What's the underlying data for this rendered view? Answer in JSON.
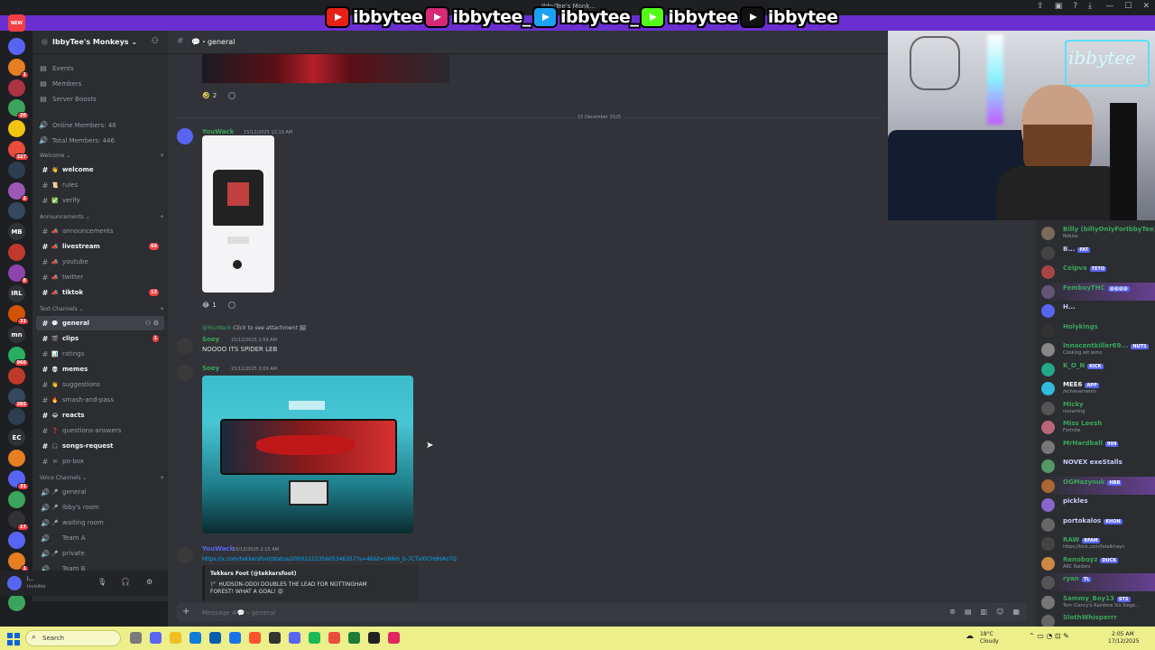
{
  "window": {
    "title": "IbbyTee's Monk..."
  },
  "socials": [
    {
      "platform": "youtube-icon",
      "color": "#e62117",
      "handle": "ibbytee"
    },
    {
      "platform": "instagram-icon",
      "color": "#d62976",
      "handle": "ibbytee_"
    },
    {
      "platform": "twitter-icon",
      "color": "#1da1f2",
      "handle": "ibbytee_"
    },
    {
      "platform": "kick-icon",
      "color": "#53fc18",
      "handle": "ibbytee"
    },
    {
      "platform": "tiktok-icon",
      "color": "#111111",
      "handle": "ibbytee"
    }
  ],
  "rail": {
    "labels": [
      "NEW",
      "MB",
      "IRL",
      "mn",
      "EC"
    ],
    "badges": [
      "1",
      "20",
      "327",
      "2",
      "8",
      "31",
      "966",
      "202",
      "31",
      "17",
      "1"
    ]
  },
  "server": {
    "name": "IbbyTee's Monkeys",
    "top_items": [
      {
        "label": "Events",
        "icon": "calendar-icon"
      },
      {
        "label": "Members",
        "icon": "members-icon"
      },
      {
        "label": "Server Boosts",
        "icon": "boost-icon"
      }
    ],
    "stats": [
      {
        "label": "Online Members: 48"
      },
      {
        "label": "Total Members: 446"
      }
    ]
  },
  "categories": [
    {
      "name": "Welcome",
      "channels": [
        {
          "emoji": "👋",
          "name": "welcome",
          "unread": true
        },
        {
          "emoji": "📜",
          "name": "rules"
        },
        {
          "emoji": "✅",
          "name": "verify"
        }
      ]
    },
    {
      "name": "Announcements",
      "channels": [
        {
          "emoji": "📣",
          "name": "announcements"
        },
        {
          "emoji": "📣",
          "name": "livestream",
          "unread": true,
          "badge": "64"
        },
        {
          "emoji": "📣",
          "name": "youtube"
        },
        {
          "emoji": "📣",
          "name": "twitter"
        },
        {
          "emoji": "📣",
          "name": "tiktok",
          "unread": true,
          "badge": "13"
        }
      ]
    },
    {
      "name": "Text Channels",
      "channels": [
        {
          "emoji": "💬",
          "name": "general",
          "active": true
        },
        {
          "emoji": "🎬",
          "name": "clips",
          "unread": true,
          "badge": "1"
        },
        {
          "emoji": "📊",
          "name": "ratings"
        },
        {
          "emoji": "💀",
          "name": "memes",
          "unread": true
        },
        {
          "emoji": "👋",
          "name": "suggestions"
        },
        {
          "emoji": "🔥",
          "name": "smash-and-pass"
        },
        {
          "emoji": "😂",
          "name": "reacts",
          "unread": true
        },
        {
          "emoji": "❓",
          "name": "questions-answers"
        },
        {
          "emoji": "🎧",
          "name": "songs-request",
          "unread": true
        },
        {
          "emoji": "✉",
          "name": "po-box"
        }
      ]
    },
    {
      "name": "Voice Channels",
      "channels": [
        {
          "emoji": "🎤",
          "name": "general",
          "voice": true
        },
        {
          "emoji": "🎤",
          "name": "ibby's room",
          "voice": true
        },
        {
          "emoji": "🎤",
          "name": "waiting room",
          "voice": true
        },
        {
          "emoji": "",
          "name": "Team A",
          "voice": true
        },
        {
          "emoji": "🎤",
          "name": "private",
          "voice": true
        },
        {
          "emoji": "",
          "name": "Team B",
          "voice": true
        }
      ]
    }
  ],
  "user": {
    "name": "i...",
    "status": "Invisible"
  },
  "channel": {
    "name": "general"
  },
  "messages": {
    "react1": {
      "emoji": "🤣",
      "count": "2"
    },
    "date_divider": "15 December 2025",
    "m1": {
      "author": "YouWack",
      "time": "15/12/2025 12:19 AM"
    },
    "react2": {
      "emoji": "😂",
      "count": "1"
    },
    "reply_ref": {
      "name": "@YouWack",
      "text": "Click to see attachment"
    },
    "m2": {
      "author": "Soey",
      "time": "15/12/2025 1:59 AM",
      "text": "NOOOO ITS SPIDER LEB"
    },
    "m3": {
      "author": "Soey",
      "time": "15/12/2025 2:09 AM"
    },
    "m4": {
      "author": "YouWack",
      "time": "15/12/2025 2:15 AM",
      "link": "https://x.com/tekkersfoot/status/2000221535605346357?s=46&t=n86m_b-7CTxl0CHdHAo7Q",
      "embed_title": "Tekkers Foot (@tekkersfoot)",
      "embed_line1": "🏴 HUDSON-ODOI DOUBLES THE LEAD FOR NOTTINGHAM",
      "embed_line2": "FOREST! WHAT A GOAL! 😍"
    }
  },
  "composer": {
    "placeholder": "Message #💬・general"
  },
  "members": [
    {
      "name": "Billy (billyOnlyForIbbyTee)",
      "status": "Roblox",
      "color": "#3ba55d",
      "avatar": "#7a6a5a"
    },
    {
      "name": "B...",
      "tag": "FAT",
      "status": "",
      "color": "#c9cdfb",
      "avatar": "#444"
    },
    {
      "name": "Ceipva",
      "tag": "TETO",
      "status": "",
      "color": "#3ba55d",
      "avatar": "#aa4444"
    },
    {
      "name": "FemboyTHC",
      "tag": "@@@@",
      "status": "",
      "color": "#3ba55d",
      "avatar": "#665577",
      "hl": true
    },
    {
      "name": "H...",
      "status": "",
      "color": "#c9cdfb",
      "avatar": "#5865f2"
    },
    {
      "name": "Holykings",
      "status": "",
      "color": "#3ba55d",
      "avatar": "#333"
    },
    {
      "name": "Innocentkiller69...",
      "tag": "NUTS",
      "status": "Cooking wit lemo",
      "color": "#3ba55d",
      "avatar": "#888"
    },
    {
      "name": "K_O_N",
      "tag": "KICK",
      "status": "",
      "color": "#3ba55d",
      "avatar": "#2a8"
    },
    {
      "name": "MEE6",
      "tag": "APP",
      "status": "/achievements",
      "color": "#f2f3f5",
      "avatar": "#3bd"
    },
    {
      "name": "Micky",
      "status": "restarting",
      "color": "#3ba55d",
      "avatar": "#555"
    },
    {
      "name": "Miss Leesh",
      "status": "Fortnite",
      "color": "#3ba55d",
      "avatar": "#b67"
    },
    {
      "name": "MrHardball",
      "tag": "999",
      "status": "",
      "color": "#3ba55d",
      "avatar": "#777"
    },
    {
      "name": "NOVEX exeStalls",
      "status": "",
      "color": "#c9cdfb",
      "avatar": "#596"
    },
    {
      "name": "OGMazyouk",
      "tag": "HBB",
      "status": "",
      "color": "#3ba55d",
      "avatar": "#a63",
      "hl": true
    },
    {
      "name": "pickles",
      "status": "",
      "color": "#c9cdfb",
      "avatar": "#86c"
    },
    {
      "name": "portokalos",
      "tag": "KHON",
      "status": "",
      "color": "#c9cdfb",
      "avatar": "#666"
    },
    {
      "name": "RAW",
      "tag": "RFAM",
      "status": "https://kick.com/fatalkhayn",
      "color": "#3ba55d",
      "avatar": "#444"
    },
    {
      "name": "Renoboyz",
      "tag": "DUCK",
      "status": "ARC Raiders",
      "color": "#3ba55d",
      "avatar": "#c84"
    },
    {
      "name": "ryan",
      "tag": "TL",
      "status": "",
      "color": "#3ba55d",
      "avatar": "#555",
      "hl": true
    },
    {
      "name": "Sammy_Boy13",
      "tag": "STS",
      "status": "Tom Clancy's Rainbow Six Siege...",
      "color": "#3ba55d",
      "avatar": "#777"
    },
    {
      "name": "SlothWhisperrr",
      "status": "",
      "color": "#3ba55d",
      "avatar": "#666"
    }
  ],
  "taskbar": {
    "search": "Search",
    "weather_temp": "18°C",
    "weather_desc": "Cloudy",
    "time": "2:05 AM",
    "date": "17/12/2025"
  }
}
